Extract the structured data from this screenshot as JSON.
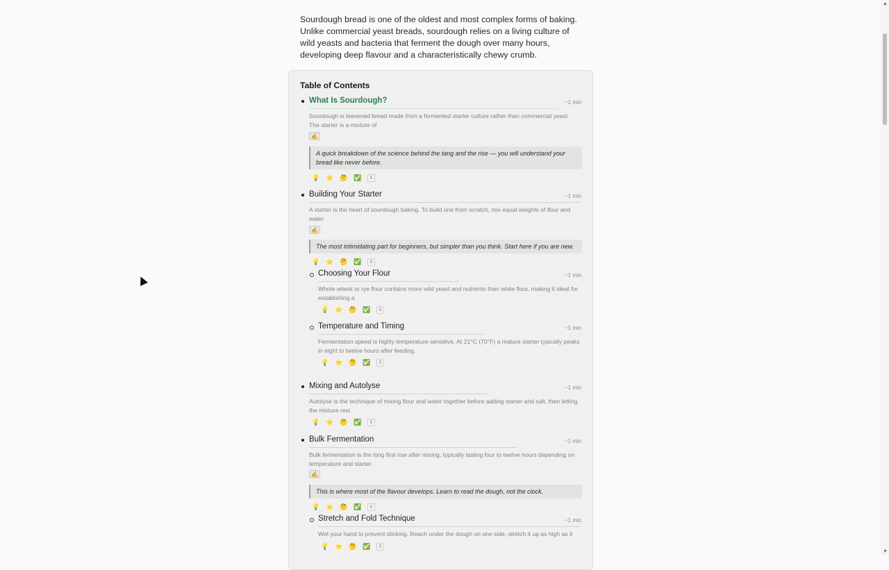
{
  "intro": "Sourdough bread is one of the oldest and most complex forms of baking. Unlike commercial yeast breads, sourdough relies on a living culture of wild yeasts and bacteria that ferment the dough over many hours, developing deep flavour and a characteristically chewy crumb.",
  "toc": {
    "title": "Table of Contents",
    "reaction_icons": [
      "lightbulb-icon",
      "star-icon",
      "thinking-icon",
      "checkmark-icon"
    ],
    "entries": [
      {
        "title": "What Is Sourdough?",
        "mins": "~1 min",
        "desc": "Sourdough is leavened bread made from a fermented starter culture rather than commercial yeast. The starter is a mixture of",
        "note": "✍",
        "quote": "A quick breakdown of the science behind the tang and the rise — you will understand your bread like never before.",
        "count": "5"
      },
      {
        "title": "Building Your Starter",
        "mins": "~1 min",
        "desc": "A starter is the heart of sourdough baking. To build one from scratch, mix equal weights of flour and water",
        "note": "✍",
        "quote": "The most intimidating part for beginners, but simpler than you think. Start here if you are new.",
        "count": "5"
      },
      {
        "title": "Choosing Your Flour",
        "mins": "~1 min",
        "desc": "Whole wheat or rye flour contains more wild yeast and nutrients than white flour, making it ideal for establishing a",
        "count": "5"
      },
      {
        "title": "Temperature and Timing",
        "mins": "~1 min",
        "desc": "Fermentation speed is highly temperature-sensitive. At 21°C (70°F) a mature starter typically peaks in eight to twelve hours after feeding.",
        "count": "5"
      },
      {
        "title": "Mixing and Autolyse",
        "mins": "~1 min",
        "desc": "Autolyse is the technique of mixing flour and water together before adding starter and salt, then letting the mixture rest",
        "count": "5"
      },
      {
        "title": "Bulk Fermentation",
        "mins": "~1 min",
        "desc": "Bulk fermentation is the long first rise after mixing, typically lasting four to twelve hours depending on temperature and starter",
        "note": "✍",
        "quote": "This is where most of the flavour develops. Learn to read the dough, not the clock.",
        "count": "5"
      },
      {
        "title": "Stretch and Fold Technique",
        "mins": "~1 min",
        "desc": "Wet your hand to prevent sticking. Reach under the dough on one side, stretch it up as high as it",
        "count": "5"
      }
    ]
  }
}
